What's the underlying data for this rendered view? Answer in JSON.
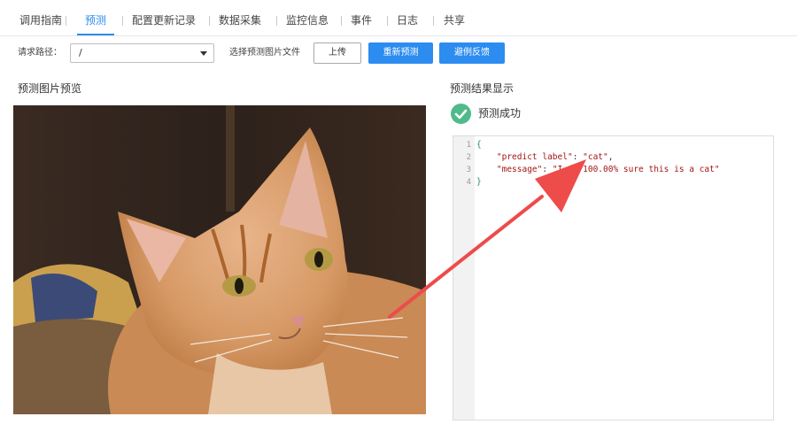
{
  "tabs": [
    {
      "label": "调用指南"
    },
    {
      "label": "预测",
      "active": true
    },
    {
      "label": "配置更新记录"
    },
    {
      "label": "数据采集"
    },
    {
      "label": "监控信息"
    },
    {
      "label": "事件"
    },
    {
      "label": "日志"
    },
    {
      "label": "共享"
    }
  ],
  "toolbar": {
    "request_path_label": "请求路径：",
    "request_path_value": "/",
    "select_file_label": "选择预测图片文件",
    "upload_label": "上传",
    "repredict_label": "重新预测",
    "feedback_label": "避例反馈"
  },
  "preview": {
    "title": "预测图片预览"
  },
  "result": {
    "title": "预测结果显示",
    "status_text": "预测成功",
    "status_color": "#4fba8b",
    "line_numbers": [
      "1",
      "2",
      "3",
      "4"
    ],
    "lines": {
      "open_brace": "{",
      "key1": "\"predict label\"",
      "val1": "\"cat\"",
      "key2": "\"message\"",
      "val2": "\"I am 100.00% sure this is a cat\"",
      "close_brace": "}"
    }
  },
  "colors": {
    "accent": "#2d8cf0",
    "success": "#4fba8b",
    "annotation_arrow": "#ee4b4b"
  }
}
